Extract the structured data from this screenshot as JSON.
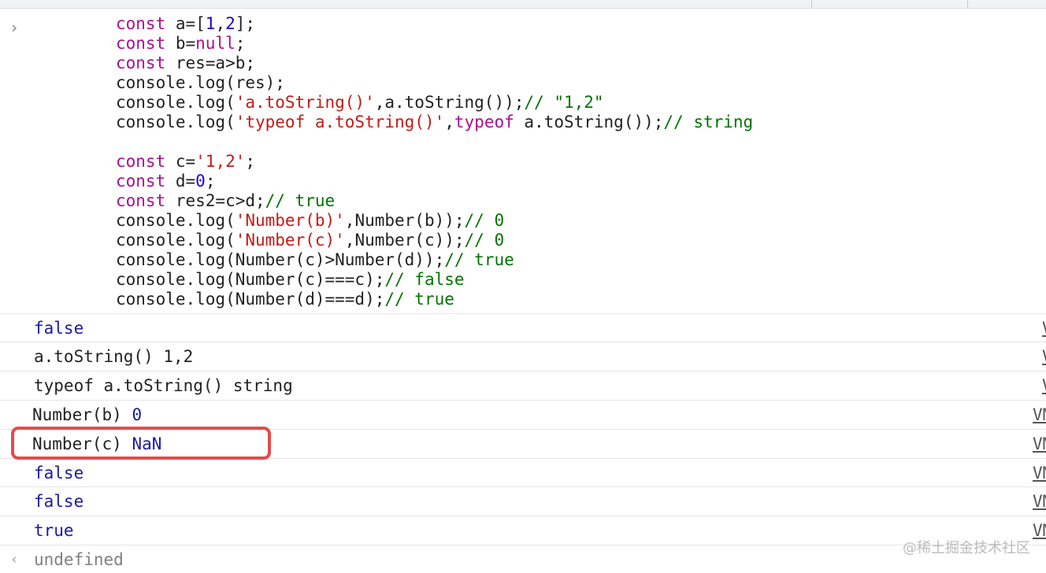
{
  "input": {
    "prompt_icon": "chevron-right-icon",
    "lines": [
      [
        {
          "t": "kw",
          "v": "const"
        },
        {
          "t": "p",
          "v": " a=["
        },
        {
          "t": "num",
          "v": "1"
        },
        {
          "t": "p",
          "v": ","
        },
        {
          "t": "num",
          "v": "2"
        },
        {
          "t": "p",
          "v": "];"
        }
      ],
      [
        {
          "t": "kw",
          "v": "const"
        },
        {
          "t": "p",
          "v": " b="
        },
        {
          "t": "kw",
          "v": "null"
        },
        {
          "t": "p",
          "v": ";"
        }
      ],
      [
        {
          "t": "kw",
          "v": "const"
        },
        {
          "t": "p",
          "v": " res=a>b;"
        }
      ],
      [
        {
          "t": "p",
          "v": "console.log(res);"
        }
      ],
      [
        {
          "t": "p",
          "v": "console.log("
        },
        {
          "t": "str",
          "v": "'a.toString()'"
        },
        {
          "t": "p",
          "v": ",a.toString());"
        },
        {
          "t": "cm",
          "v": "// \"1,2\""
        }
      ],
      [
        {
          "t": "p",
          "v": "console.log("
        },
        {
          "t": "str",
          "v": "'typeof a.toString()'"
        },
        {
          "t": "p",
          "v": ","
        },
        {
          "t": "kw",
          "v": "typeof"
        },
        {
          "t": "p",
          "v": " a.toString());"
        },
        {
          "t": "cm",
          "v": "// string"
        }
      ],
      [],
      [
        {
          "t": "kw",
          "v": "const"
        },
        {
          "t": "p",
          "v": " c="
        },
        {
          "t": "str",
          "v": "'1,2'"
        },
        {
          "t": "p",
          "v": ";"
        }
      ],
      [
        {
          "t": "kw",
          "v": "const"
        },
        {
          "t": "p",
          "v": " d="
        },
        {
          "t": "num",
          "v": "0"
        },
        {
          "t": "p",
          "v": ";"
        }
      ],
      [
        {
          "t": "kw",
          "v": "const"
        },
        {
          "t": "p",
          "v": " res2=c>d;"
        },
        {
          "t": "cm",
          "v": "// true"
        }
      ],
      [
        {
          "t": "p",
          "v": "console.log("
        },
        {
          "t": "str",
          "v": "'Number(b)'"
        },
        {
          "t": "p",
          "v": ",Number(b));"
        },
        {
          "t": "cm",
          "v": "// 0"
        }
      ],
      [
        {
          "t": "p",
          "v": "console.log("
        },
        {
          "t": "str",
          "v": "'Number(c)'"
        },
        {
          "t": "p",
          "v": ",Number(c));"
        },
        {
          "t": "cm",
          "v": "// 0"
        }
      ],
      [
        {
          "t": "p",
          "v": "console.log(Number(c)>Number(d));"
        },
        {
          "t": "cm",
          "v": "// true"
        }
      ],
      [
        {
          "t": "p",
          "v": "console.log(Number(c)===c);"
        },
        {
          "t": "cm",
          "v": "// false"
        }
      ],
      [
        {
          "t": "p",
          "v": "console.log(Number(d)===d);"
        },
        {
          "t": "cm",
          "v": "// true"
        }
      ]
    ]
  },
  "output": [
    {
      "label": "",
      "value": "false",
      "source": "V"
    },
    {
      "label": "a.toString() 1,2",
      "value": "",
      "source": "V"
    },
    {
      "label": "typeof a.toString() string",
      "value": "",
      "source": "V"
    },
    {
      "label": "Number(b) ",
      "value": "0",
      "source": "VM"
    },
    {
      "label": "Number(c) ",
      "value": "NaN",
      "source": "VM"
    },
    {
      "label": "",
      "value": "false",
      "source": "VM"
    },
    {
      "label": "",
      "value": "false",
      "source": "VM"
    },
    {
      "label": "",
      "value": "true",
      "source": "VM"
    }
  ],
  "return_row": {
    "arrow_icon": "return-arrow-icon",
    "value": "undefined"
  },
  "watermark": "@稀土掘金技术社区",
  "colors": {
    "keyword": "#aa0d91",
    "number": "#1c00cf",
    "string": "#c41a16",
    "comment": "#007400",
    "log_value": "#1a1aa6",
    "highlight": "#e54b4b"
  }
}
